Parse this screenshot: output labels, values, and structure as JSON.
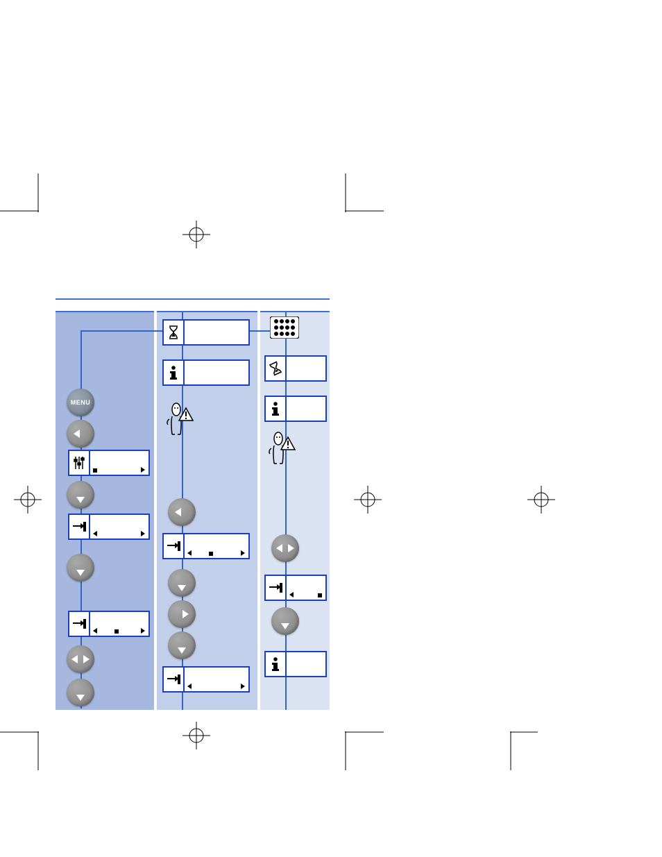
{
  "buttons": {
    "menu": "MENU"
  },
  "icons": {
    "hourglass": "hourglass-icon",
    "info": "info-icon",
    "settings": "settings-icon",
    "goto": "goto-icon",
    "keypad": "keypad-icon",
    "hourglass_diag": "hourglass-diagonal-icon",
    "person_warn": "person-warning-icon"
  },
  "columns": {
    "count": 3
  }
}
